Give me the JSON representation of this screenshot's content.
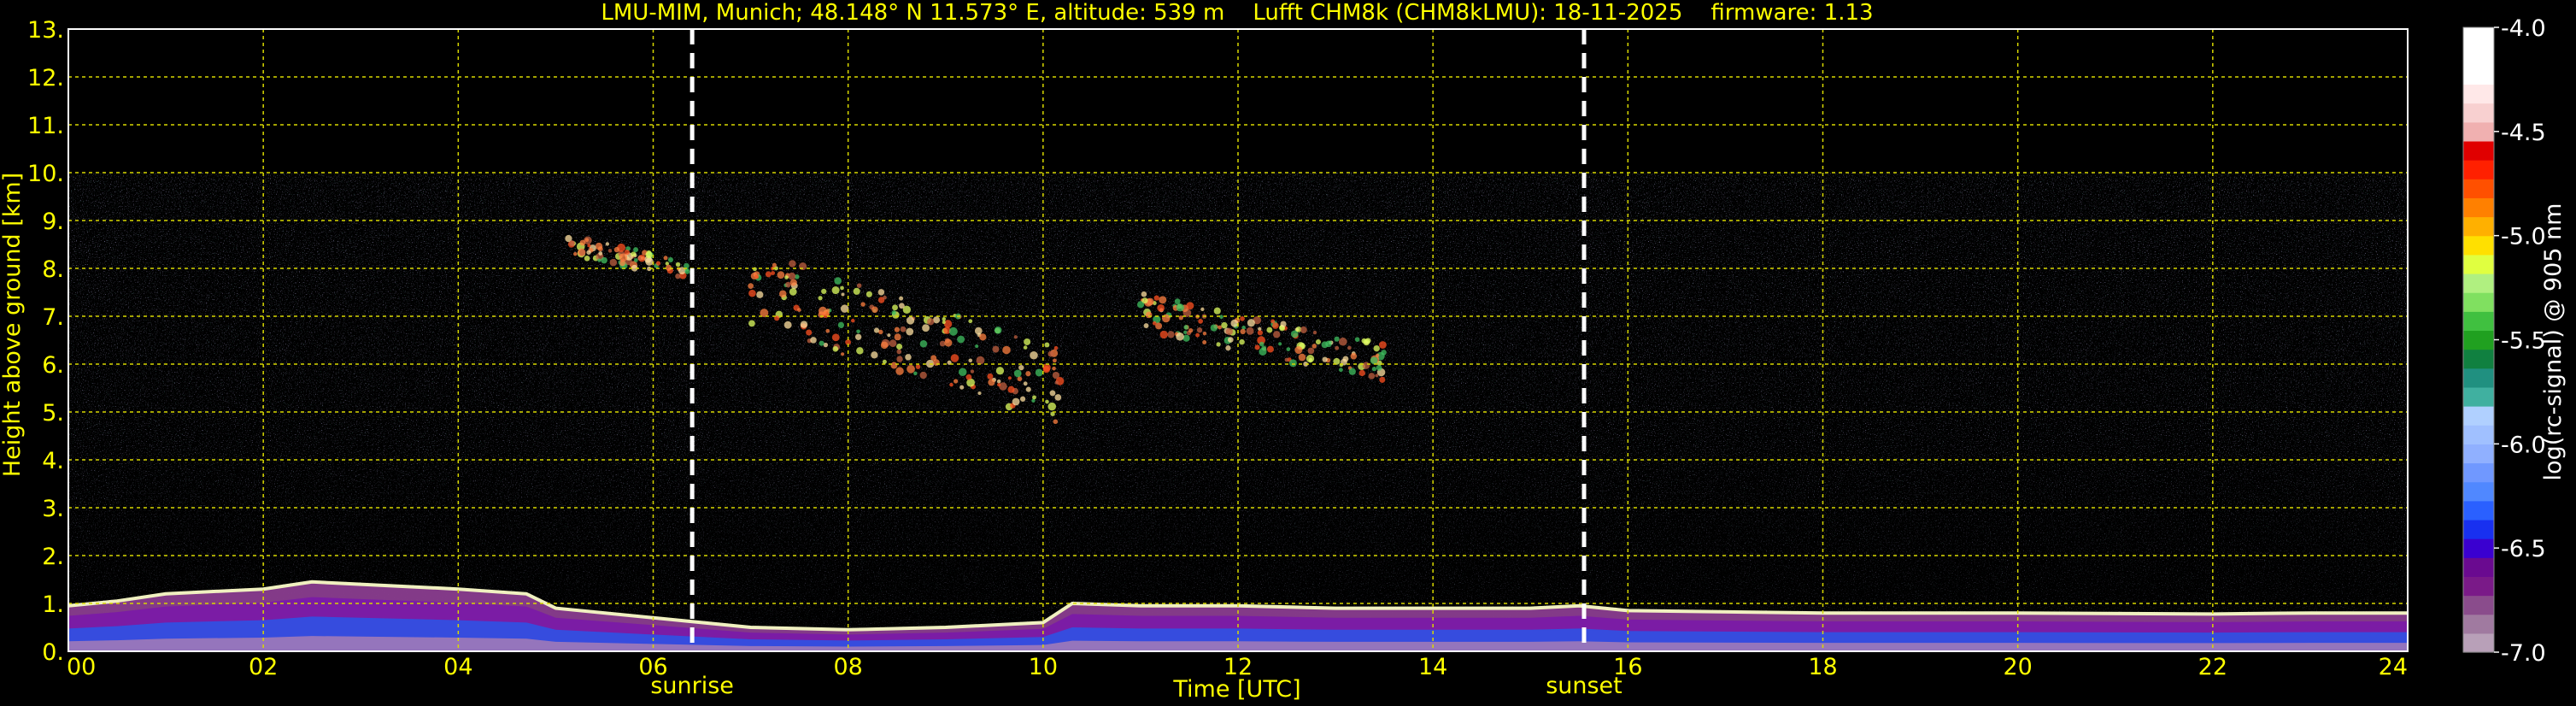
{
  "chart_data": {
    "type": "heatmap",
    "title": "LMU-MIM, Munich; 48.148° N 11.573° E, altitude: 539 m    Lufft CHM8k (CHM8kLMU): 18-11-2025    firmware: 1.13",
    "xlabel": "Time [UTC]",
    "ylabel": "Height above ground [km]",
    "xlim": [
      0,
      24
    ],
    "ylim": [
      0,
      13
    ],
    "x_ticks": [
      "00",
      "02",
      "04",
      "06",
      "08",
      "10",
      "12",
      "14",
      "16",
      "18",
      "20",
      "22",
      "24"
    ],
    "y_ticks": [
      "0.",
      "1.",
      "2.",
      "3.",
      "4.",
      "5.",
      "6.",
      "7.",
      "8.",
      "9.",
      "10.",
      "11.",
      "12.",
      "13."
    ],
    "grid": true,
    "signal_top_km": 10,
    "markers": [
      {
        "label": "sunrise",
        "time_h": 6.4
      },
      {
        "label": "sunset",
        "time_h": 15.55
      }
    ],
    "colorbar": {
      "label": "log(rc-signal) @ 905 nm",
      "range": [
        -7.0,
        -4.0
      ],
      "ticks": [
        "-4.0",
        "-4.5",
        "-5.0",
        "-5.5",
        "-6.0",
        "-6.5",
        "-7.0"
      ],
      "colors": [
        "#b8a0b8",
        "#a07aa0",
        "#8a4c8c",
        "#7a1a88",
        "#6a0a90",
        "#3a00d0",
        "#1830f0",
        "#2a60ff",
        "#5088ff",
        "#7098ff",
        "#90b0ff",
        "#a0c0ff",
        "#b0d0ff",
        "#40b0a0",
        "#209080",
        "#108040",
        "#20a020",
        "#40c040",
        "#80e060",
        "#b0f080",
        "#e0ff40",
        "#ffe000",
        "#ffb000",
        "#ff8000",
        "#ff5000",
        "#ff2000",
        "#e00000",
        "#f0b0b0",
        "#f8d0d0",
        "#ffe8e8",
        "#ffffff",
        "#ffffff",
        "#ffffff"
      ]
    },
    "boundary_layer_top_km": [
      [
        0,
        0.95
      ],
      [
        0.5,
        1.05
      ],
      [
        1,
        1.2
      ],
      [
        2,
        1.3
      ],
      [
        2.5,
        1.45
      ],
      [
        3,
        1.4
      ],
      [
        4,
        1.3
      ],
      [
        4.7,
        1.2
      ],
      [
        5,
        0.9
      ],
      [
        6,
        0.7
      ],
      [
        7,
        0.5
      ],
      [
        8,
        0.45
      ],
      [
        9,
        0.5
      ],
      [
        10,
        0.6
      ],
      [
        10.3,
        1.0
      ],
      [
        11,
        0.95
      ],
      [
        12,
        0.95
      ],
      [
        13,
        0.9
      ],
      [
        14,
        0.9
      ],
      [
        15,
        0.9
      ],
      [
        15.5,
        0.95
      ],
      [
        16,
        0.85
      ],
      [
        18,
        0.8
      ],
      [
        20,
        0.8
      ],
      [
        22,
        0.78
      ],
      [
        23,
        0.8
      ],
      [
        24,
        0.8
      ]
    ],
    "cloud_layers": [
      {
        "time_h": [
          5.1,
          6.4
        ],
        "height_km": [
          7.8,
          8.7
        ]
      },
      {
        "time_h": [
          7.0,
          10.2
        ],
        "height_km": [
          4.9,
          8.4
        ]
      },
      {
        "time_h": [
          11.0,
          13.5
        ],
        "height_km": [
          5.7,
          7.5
        ]
      }
    ]
  }
}
